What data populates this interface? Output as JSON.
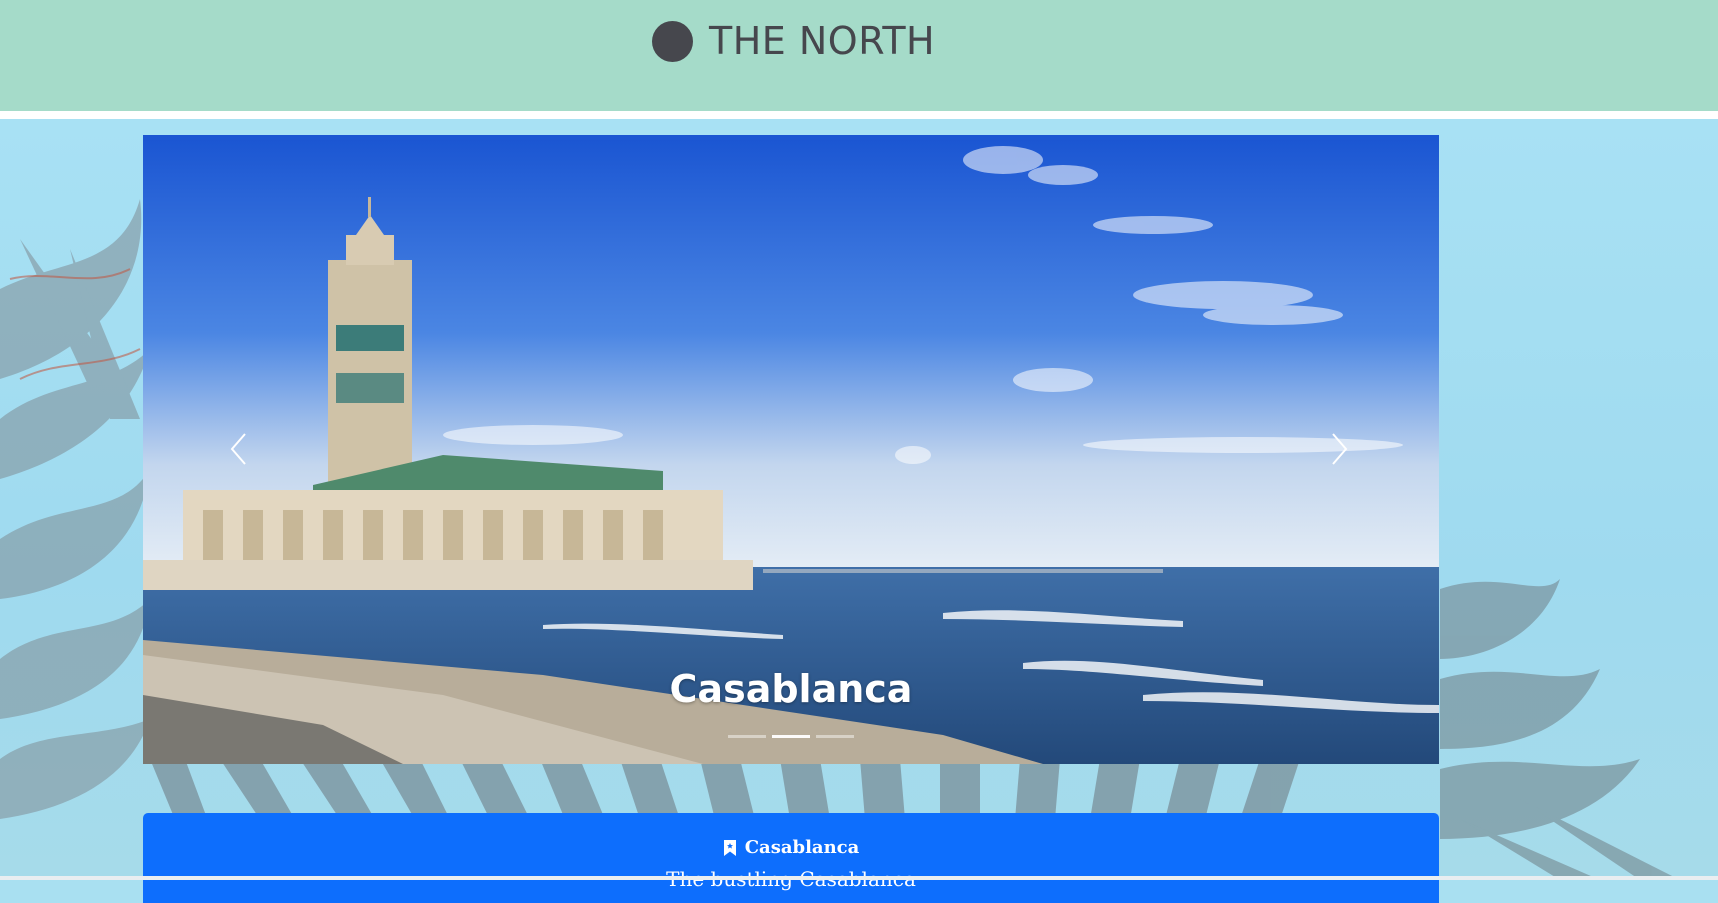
{
  "header": {
    "brand_title": "THE NORTH",
    "background_color": "#a5dbc9",
    "logo_icon": "circle-logo-icon"
  },
  "carousel": {
    "caption": "Casablanca",
    "prev_icon": "chevron-left-icon",
    "next_icon": "chevron-right-icon",
    "slide_count": 3,
    "active_index": 1
  },
  "info_card": {
    "icon": "bookmark-icon",
    "title": "Casablanca",
    "subtitle": "The bustling Casablanca",
    "background_color": "#0d6efd"
  }
}
